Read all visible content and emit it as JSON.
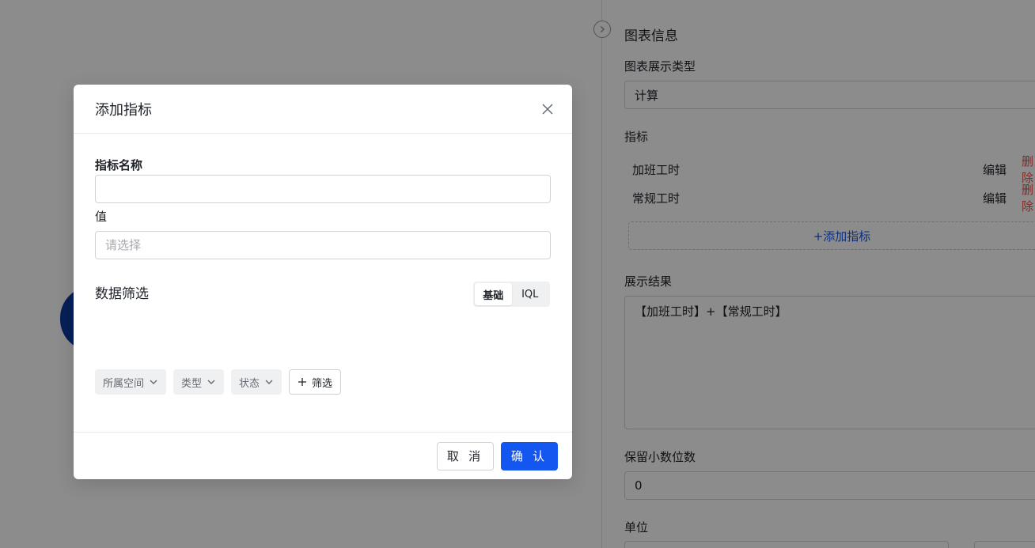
{
  "panel": {
    "title": "图表信息",
    "chart_type_label": "图表展示类型",
    "chart_type_value": "计算",
    "metrics_label": "指标",
    "metrics": [
      {
        "name": "加班工时",
        "edit": "编辑",
        "delete": "删除"
      },
      {
        "name": "常规工时",
        "edit": "编辑",
        "delete": "删除"
      }
    ],
    "add_metric": "+添加指标",
    "result_label": "展示结果",
    "result_value": "【加班工时】+【常规工时】",
    "decimals_label": "保留小数位数",
    "decimals_value": "0",
    "unit_label": "单位"
  },
  "modal": {
    "title": "添加指标",
    "name_label": "指标名称",
    "name_value": "",
    "value_label": "值",
    "value_placeholder": "请选择",
    "filter_title": "数据筛选",
    "mode_basic": "基础",
    "mode_iql": "IQL",
    "filters": [
      "所属空间",
      "类型",
      "状态"
    ],
    "add_filter": "筛选",
    "cancel": "取 消",
    "confirm": "确 认"
  },
  "colors": {
    "primary": "#1456f0",
    "danger": "#f54a45",
    "overlay": "rgba(0,0,0,0.45)"
  }
}
